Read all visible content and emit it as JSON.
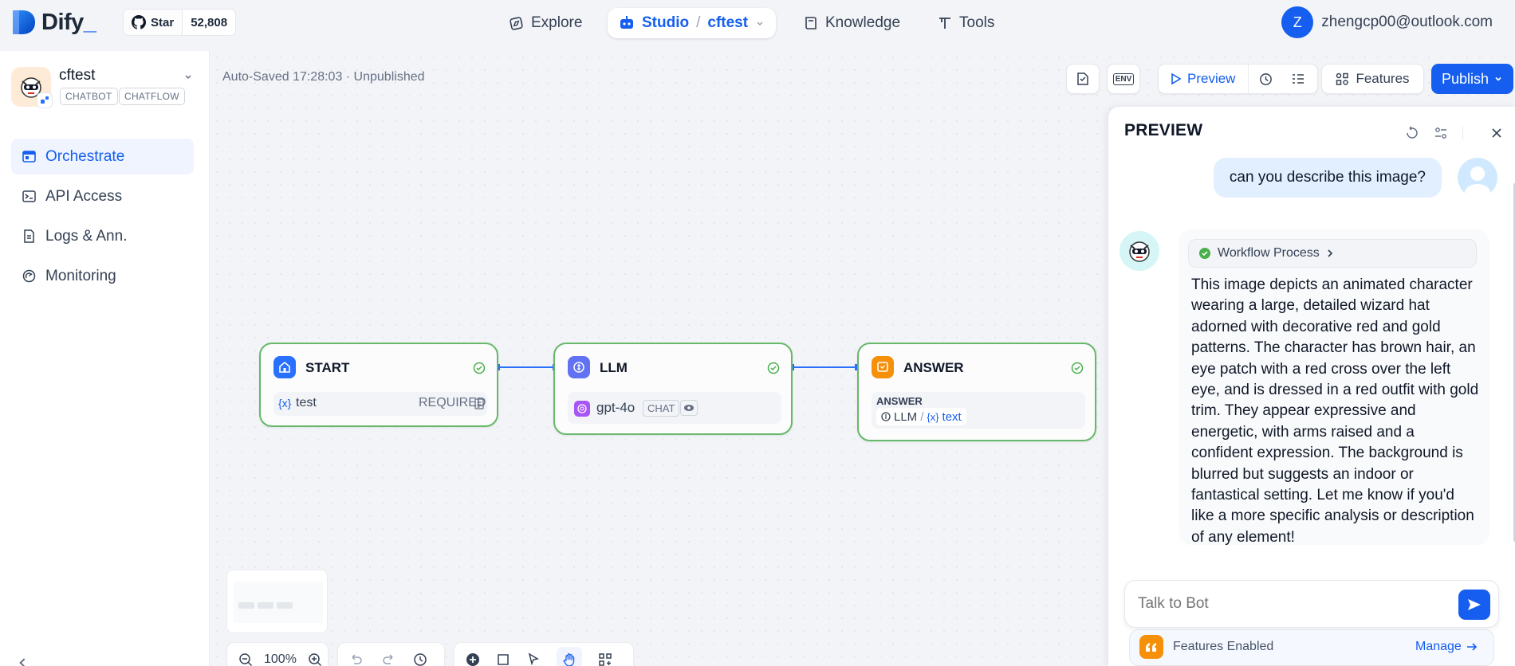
{
  "app": {
    "brand": "Dify",
    "github": {
      "star_label": "Star",
      "star_count": "52,808"
    },
    "account_initial": "Z",
    "account_email": "zhengcp00@outlook.com"
  },
  "nav": {
    "explore": "Explore",
    "studio": "Studio",
    "current_app": "cftest",
    "knowledge": "Knowledge",
    "tools": "Tools"
  },
  "sidebar": {
    "app_name": "cftest",
    "tags": [
      "CHATBOT",
      "CHATFLOW"
    ],
    "items": [
      {
        "label": "Orchestrate",
        "icon": "orchestrate-icon",
        "active": true
      },
      {
        "label": "API Access",
        "icon": "terminal-icon",
        "active": false
      },
      {
        "label": "Logs & Ann.",
        "icon": "logs-icon",
        "active": false
      },
      {
        "label": "Monitoring",
        "icon": "monitoring-icon",
        "active": false
      }
    ]
  },
  "toolbar": {
    "status": "Auto-Saved 17:28:03 · Unpublished",
    "env_label": "ENV",
    "preview_label": "Preview",
    "features_label": "Features",
    "publish_label": "Publish"
  },
  "nodes": {
    "start": {
      "title": "START",
      "var_icon": "{x}",
      "var_name": "test",
      "var_req": "REQUIRED"
    },
    "llm": {
      "title": "LLM",
      "model": "gpt-4o",
      "mode": "CHAT"
    },
    "answer": {
      "title": "ANSWER",
      "label": "ANSWER",
      "src_node": "LLM",
      "slash": "/",
      "var_icon": "{x}",
      "var_name": "text"
    }
  },
  "canvas_controls": {
    "zoom": "100%"
  },
  "preview": {
    "title": "PREVIEW",
    "user_message": "can you describe this image?",
    "workflow_label": "Workflow Process",
    "answer": "This image depicts an animated character wearing a large, detailed wizard hat adorned with decorative red and gold patterns. The character has brown hair, an eye patch with a red cross over the left eye, and is dressed in a red outfit with gold trim. They appear expressive and energetic, with arms raised and a confident expression. The background is blurred but suggests an indoor or fantastical setting. Let me know if you'd like a more specific analysis or description of any element!",
    "input_placeholder": "Talk to Bot",
    "features_enabled": "Features Enabled",
    "manage_label": "Manage"
  },
  "colors": {
    "accent": "#155eef",
    "node_border": "#67b868",
    "edge": "#2970ff"
  }
}
